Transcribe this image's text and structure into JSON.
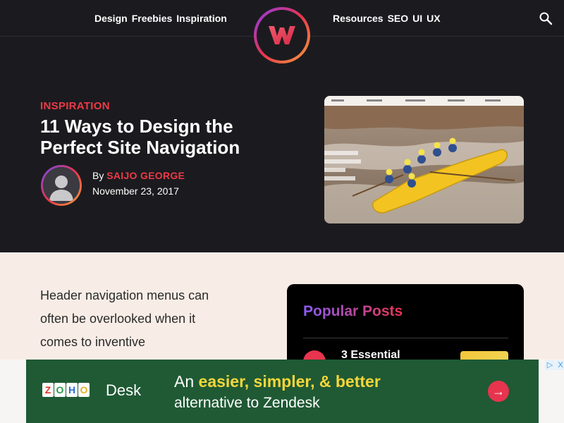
{
  "nav": {
    "left_links": [
      "Design",
      "Freebies",
      "Inspiration"
    ],
    "right_links": [
      "Resources",
      "SEO",
      "UI",
      "UX"
    ]
  },
  "colors": {
    "accent": "#ee3a46",
    "dark_bg": "#1b1b1f",
    "light_bg": "#f8ede6",
    "ad_green": "#1f5a34",
    "ad_highlight": "#f6d63a"
  },
  "article": {
    "category": "INSPIRATION",
    "title": "11 Ways to Design the Perfect Site Navigation",
    "by_prefix": "By",
    "author": "SAIJO GEORGE",
    "date": "November 23, 2017",
    "intro": "Header navigation menus can often be overlooked when it comes to inventive"
  },
  "sidebar": {
    "popular_title": "Popular Posts",
    "first_post_title": "3 Essential"
  },
  "ad": {
    "logo_letters": [
      "Z",
      "O",
      "H",
      "O"
    ],
    "logo_product": "Desk",
    "line1_prefix": "An",
    "line1_highlight": "easier, simpler, & better",
    "line2": "alternative to Zendesk",
    "arrow_icon": "→",
    "adchoices_info": "▷",
    "adchoices_close": "X"
  },
  "icons": {
    "search": "search-icon",
    "logo": "w-logo-icon",
    "avatar": "user-silhouette-icon"
  }
}
